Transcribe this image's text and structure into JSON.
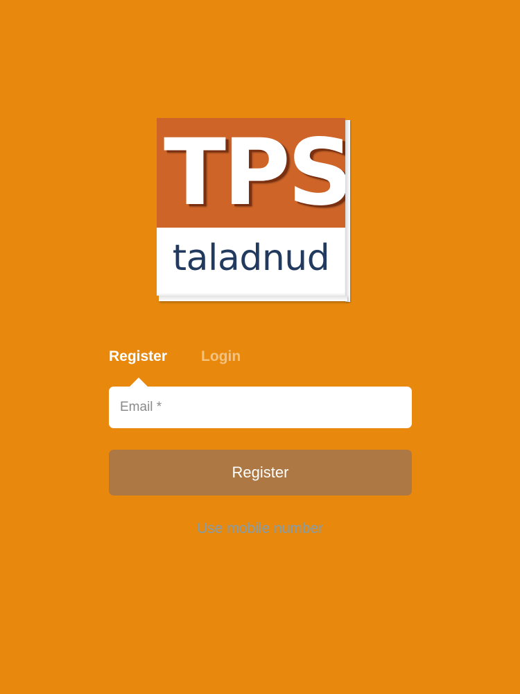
{
  "logo": {
    "main_text": "TPS",
    "sub_text": "taladnud"
  },
  "tabs": [
    {
      "label": "Register",
      "active": true
    },
    {
      "label": "Login",
      "active": false
    }
  ],
  "form": {
    "email_placeholder": "Email *",
    "email_value": "",
    "submit_label": "Register"
  },
  "alt_link": {
    "label": "Use mobile number"
  },
  "colors": {
    "background": "#E8890E",
    "logo_orange": "#CE6428",
    "logo_navy": "#223A5E",
    "button": "#AD7844",
    "link": "#7F9CB0",
    "inactive_tab": "#F5C27E"
  }
}
